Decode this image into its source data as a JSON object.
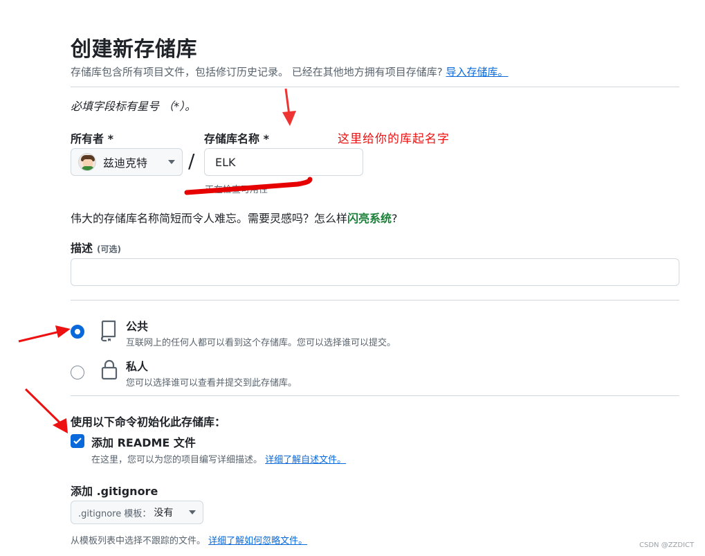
{
  "header": {
    "title": "创建新存储库",
    "subtitle": "存储库包含所有项目文件，包括修订历史记录。 已经在其他地方拥有项目存储库?",
    "import_link": "导入存储库。"
  },
  "required_note": "必填字段标有星号 （*）。",
  "owner": {
    "label": "所有者 *",
    "value": "兹迪克特"
  },
  "separator": "/",
  "repo_name": {
    "label": "存储库名称 *",
    "value": "ELK",
    "status": "正在检查可用性"
  },
  "annotation": {
    "text": "这里给你的库起名字",
    "color": "#ee1111"
  },
  "inspiration": {
    "text": "伟大的存储库名称简短而令人难忘。需要灵感吗？怎么样",
    "suggestion": "闪亮系统",
    "suffix": "?"
  },
  "description": {
    "label": "描述",
    "optional": "(可选)",
    "value": ""
  },
  "visibility": {
    "options": [
      {
        "title": "公共",
        "desc": "互联网上的任何人都可以看到这个存储库。您可以选择谁可以提交。",
        "selected": true,
        "icon": "repo-icon"
      },
      {
        "title": "私人",
        "desc": "您可以选择谁可以查看并提交到此存储库。",
        "selected": false,
        "icon": "lock-icon"
      }
    ]
  },
  "init": {
    "title": "使用以下命令初始化此存储库：",
    "readme_label": "添加 README 文件",
    "readme_checked": true,
    "readme_desc": "在这里，您可以为您的项目编写详细描述。",
    "readme_link": "详细了解自述文件。"
  },
  "gitignore": {
    "label": "添加 .gitignore",
    "select_prefix": ".gitignore 模板：",
    "select_value": "没有",
    "note": "从模板列表中选择不跟踪的文件。",
    "note_link": "详细了解如何忽略文件。"
  },
  "watermark": "CSDN @ZZDICT",
  "colors": {
    "accent": "#0969da",
    "green": "#1a7f37",
    "annotation_red": "#ee1111"
  }
}
